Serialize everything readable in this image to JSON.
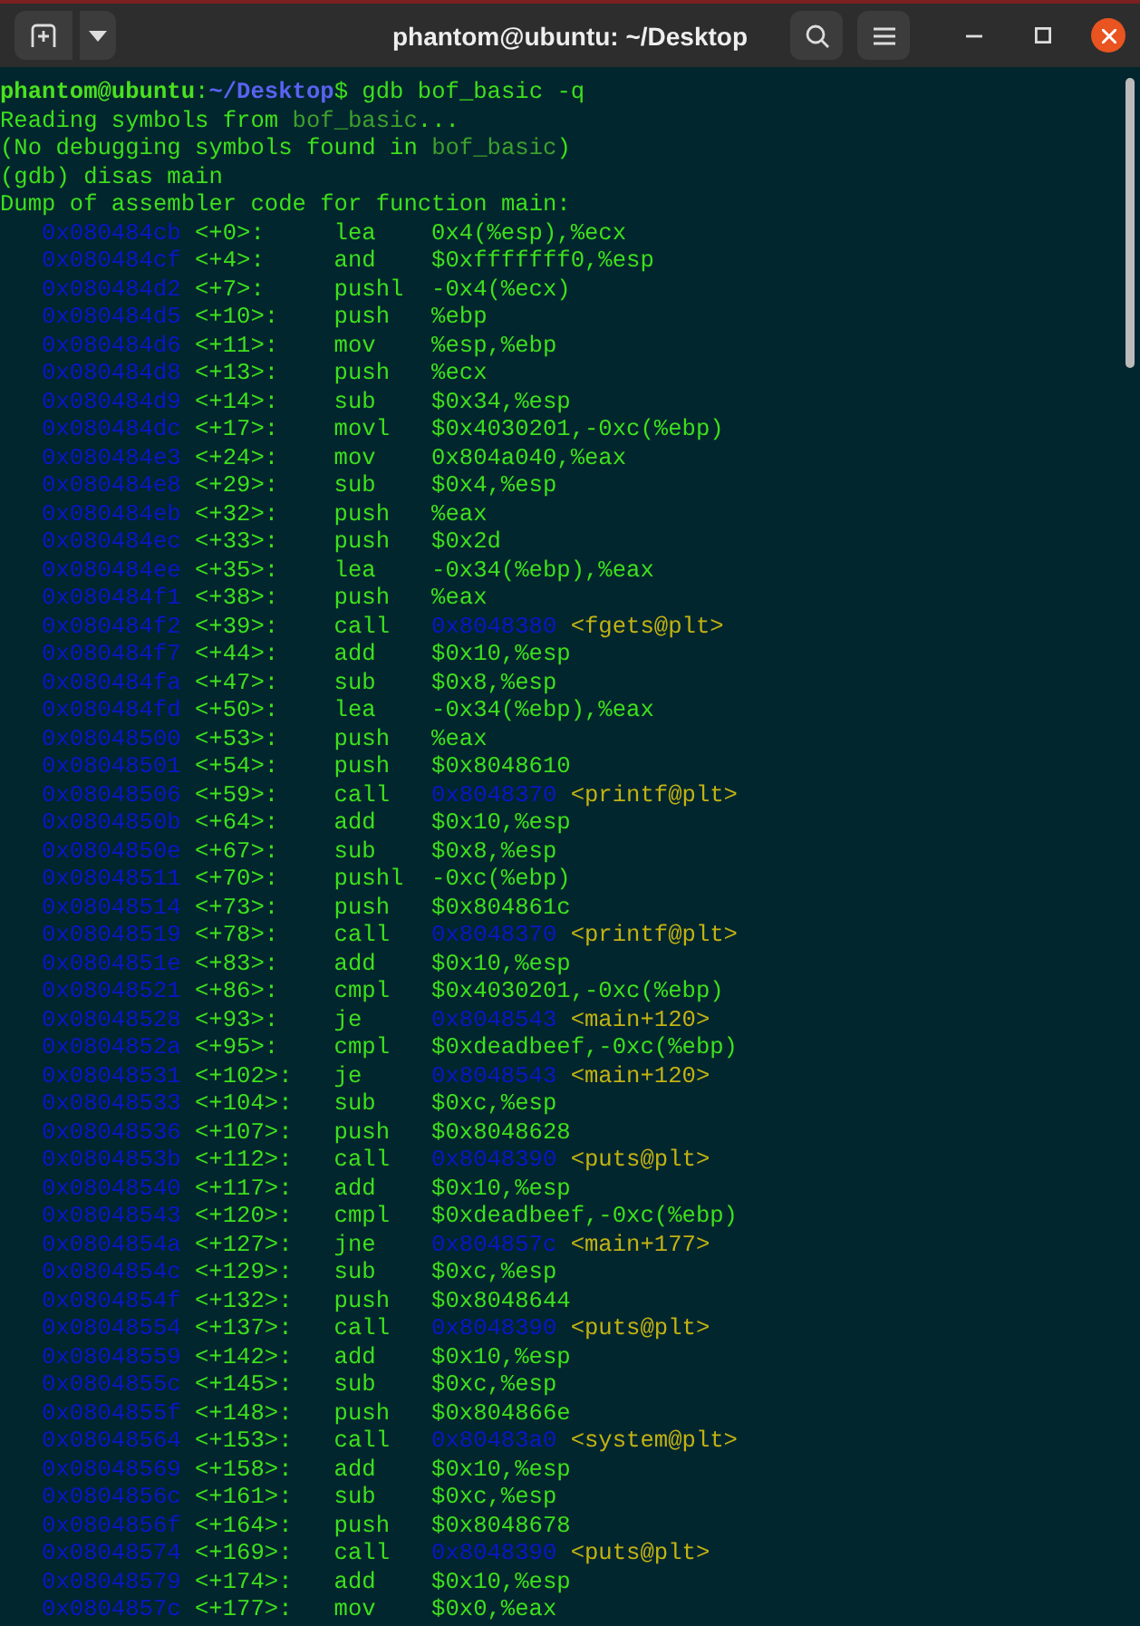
{
  "window": {
    "title": "phantom@ubuntu: ~/Desktop"
  },
  "output_lines": [
    {
      "segments": [
        {
          "kind": "user",
          "text": "phantom@ubuntu"
        },
        {
          "kind": "plain",
          "text": ":"
        },
        {
          "kind": "path",
          "text": "~/Desktop"
        },
        {
          "kind": "plain",
          "text": "$ gdb bof_basic -q"
        }
      ]
    },
    {
      "segments": [
        {
          "kind": "plain",
          "text": "Reading symbols from "
        },
        {
          "kind": "filename",
          "text": "bof_basic"
        },
        {
          "kind": "plain",
          "text": "..."
        }
      ]
    },
    {
      "segments": [
        {
          "kind": "plain",
          "text": "(No debugging symbols found in "
        },
        {
          "kind": "filename",
          "text": "bof_basic"
        },
        {
          "kind": "plain",
          "text": ")"
        }
      ]
    },
    {
      "segments": [
        {
          "kind": "plain",
          "text": "(gdb) disas main"
        }
      ]
    },
    {
      "segments": [
        {
          "kind": "plain",
          "text": "Dump of assembler code for function main:"
        }
      ]
    }
  ],
  "instructions": [
    {
      "address": "0x080484cb",
      "offset": "<+0>:",
      "mnemonic": "lea",
      "operands": "0x4(%esp),%ecx"
    },
    {
      "address": "0x080484cf",
      "offset": "<+4>:",
      "mnemonic": "and",
      "operands": "$0xfffffff0,%esp"
    },
    {
      "address": "0x080484d2",
      "offset": "<+7>:",
      "mnemonic": "pushl",
      "operands": "-0x4(%ecx)"
    },
    {
      "address": "0x080484d5",
      "offset": "<+10>:",
      "mnemonic": "push",
      "operands": "%ebp"
    },
    {
      "address": "0x080484d6",
      "offset": "<+11>:",
      "mnemonic": "mov",
      "operands": "%esp,%ebp"
    },
    {
      "address": "0x080484d8",
      "offset": "<+13>:",
      "mnemonic": "push",
      "operands": "%ecx"
    },
    {
      "address": "0x080484d9",
      "offset": "<+14>:",
      "mnemonic": "sub",
      "operands": "$0x34,%esp"
    },
    {
      "address": "0x080484dc",
      "offset": "<+17>:",
      "mnemonic": "movl",
      "operands": "$0x4030201,-0xc(%ebp)"
    },
    {
      "address": "0x080484e3",
      "offset": "<+24>:",
      "mnemonic": "mov",
      "operands": "0x804a040,%eax"
    },
    {
      "address": "0x080484e8",
      "offset": "<+29>:",
      "mnemonic": "sub",
      "operands": "$0x4,%esp"
    },
    {
      "address": "0x080484eb",
      "offset": "<+32>:",
      "mnemonic": "push",
      "operands": "%eax"
    },
    {
      "address": "0x080484ec",
      "offset": "<+33>:",
      "mnemonic": "push",
      "operands": "$0x2d"
    },
    {
      "address": "0x080484ee",
      "offset": "<+35>:",
      "mnemonic": "lea",
      "operands": "-0x34(%ebp),%eax"
    },
    {
      "address": "0x080484f1",
      "offset": "<+38>:",
      "mnemonic": "push",
      "operands": "%eax"
    },
    {
      "address": "0x080484f2",
      "offset": "<+39>:",
      "mnemonic": "call",
      "target": "0x8048380",
      "symbol": "<fgets@plt>"
    },
    {
      "address": "0x080484f7",
      "offset": "<+44>:",
      "mnemonic": "add",
      "operands": "$0x10,%esp"
    },
    {
      "address": "0x080484fa",
      "offset": "<+47>:",
      "mnemonic": "sub",
      "operands": "$0x8,%esp"
    },
    {
      "address": "0x080484fd",
      "offset": "<+50>:",
      "mnemonic": "lea",
      "operands": "-0x34(%ebp),%eax"
    },
    {
      "address": "0x08048500",
      "offset": "<+53>:",
      "mnemonic": "push",
      "operands": "%eax"
    },
    {
      "address": "0x08048501",
      "offset": "<+54>:",
      "mnemonic": "push",
      "operands": "$0x8048610"
    },
    {
      "address": "0x08048506",
      "offset": "<+59>:",
      "mnemonic": "call",
      "target": "0x8048370",
      "symbol": "<printf@plt>"
    },
    {
      "address": "0x0804850b",
      "offset": "<+64>:",
      "mnemonic": "add",
      "operands": "$0x10,%esp"
    },
    {
      "address": "0x0804850e",
      "offset": "<+67>:",
      "mnemonic": "sub",
      "operands": "$0x8,%esp"
    },
    {
      "address": "0x08048511",
      "offset": "<+70>:",
      "mnemonic": "pushl",
      "operands": "-0xc(%ebp)"
    },
    {
      "address": "0x08048514",
      "offset": "<+73>:",
      "mnemonic": "push",
      "operands": "$0x804861c"
    },
    {
      "address": "0x08048519",
      "offset": "<+78>:",
      "mnemonic": "call",
      "target": "0x8048370",
      "symbol": "<printf@plt>"
    },
    {
      "address": "0x0804851e",
      "offset": "<+83>:",
      "mnemonic": "add",
      "operands": "$0x10,%esp"
    },
    {
      "address": "0x08048521",
      "offset": "<+86>:",
      "mnemonic": "cmpl",
      "operands": "$0x4030201,-0xc(%ebp)"
    },
    {
      "address": "0x08048528",
      "offset": "<+93>:",
      "mnemonic": "je",
      "target": "0x8048543",
      "symbol": "<main+120>"
    },
    {
      "address": "0x0804852a",
      "offset": "<+95>:",
      "mnemonic": "cmpl",
      "operands": "$0xdeadbeef,-0xc(%ebp)"
    },
    {
      "address": "0x08048531",
      "offset": "<+102>:",
      "mnemonic": "je",
      "target": "0x8048543",
      "symbol": "<main+120>"
    },
    {
      "address": "0x08048533",
      "offset": "<+104>:",
      "mnemonic": "sub",
      "operands": "$0xc,%esp"
    },
    {
      "address": "0x08048536",
      "offset": "<+107>:",
      "mnemonic": "push",
      "operands": "$0x8048628"
    },
    {
      "address": "0x0804853b",
      "offset": "<+112>:",
      "mnemonic": "call",
      "target": "0x8048390",
      "symbol": "<puts@plt>"
    },
    {
      "address": "0x08048540",
      "offset": "<+117>:",
      "mnemonic": "add",
      "operands": "$0x10,%esp"
    },
    {
      "address": "0x08048543",
      "offset": "<+120>:",
      "mnemonic": "cmpl",
      "operands": "$0xdeadbeef,-0xc(%ebp)"
    },
    {
      "address": "0x0804854a",
      "offset": "<+127>:",
      "mnemonic": "jne",
      "target": "0x804857c",
      "symbol": "<main+177>"
    },
    {
      "address": "0x0804854c",
      "offset": "<+129>:",
      "mnemonic": "sub",
      "operands": "$0xc,%esp"
    },
    {
      "address": "0x0804854f",
      "offset": "<+132>:",
      "mnemonic": "push",
      "operands": "$0x8048644"
    },
    {
      "address": "0x08048554",
      "offset": "<+137>:",
      "mnemonic": "call",
      "target": "0x8048390",
      "symbol": "<puts@plt>"
    },
    {
      "address": "0x08048559",
      "offset": "<+142>:",
      "mnemonic": "add",
      "operands": "$0x10,%esp"
    },
    {
      "address": "0x0804855c",
      "offset": "<+145>:",
      "mnemonic": "sub",
      "operands": "$0xc,%esp"
    },
    {
      "address": "0x0804855f",
      "offset": "<+148>:",
      "mnemonic": "push",
      "operands": "$0x804866e"
    },
    {
      "address": "0x08048564",
      "offset": "<+153>:",
      "mnemonic": "call",
      "target": "0x80483a0",
      "symbol": "<system@plt>"
    },
    {
      "address": "0x08048569",
      "offset": "<+158>:",
      "mnemonic": "add",
      "operands": "$0x10,%esp"
    },
    {
      "address": "0x0804856c",
      "offset": "<+161>:",
      "mnemonic": "sub",
      "operands": "$0xc,%esp"
    },
    {
      "address": "0x0804856f",
      "offset": "<+164>:",
      "mnemonic": "push",
      "operands": "$0x8048678"
    },
    {
      "address": "0x08048574",
      "offset": "<+169>:",
      "mnemonic": "call",
      "target": "0x8048390",
      "symbol": "<puts@plt>"
    },
    {
      "address": "0x08048579",
      "offset": "<+174>:",
      "mnemonic": "add",
      "operands": "$0x10,%esp"
    },
    {
      "address": "0x0804857c",
      "offset": "<+177>:",
      "mnemonic": "mov",
      "operands": "$0x0,%eax"
    }
  ]
}
